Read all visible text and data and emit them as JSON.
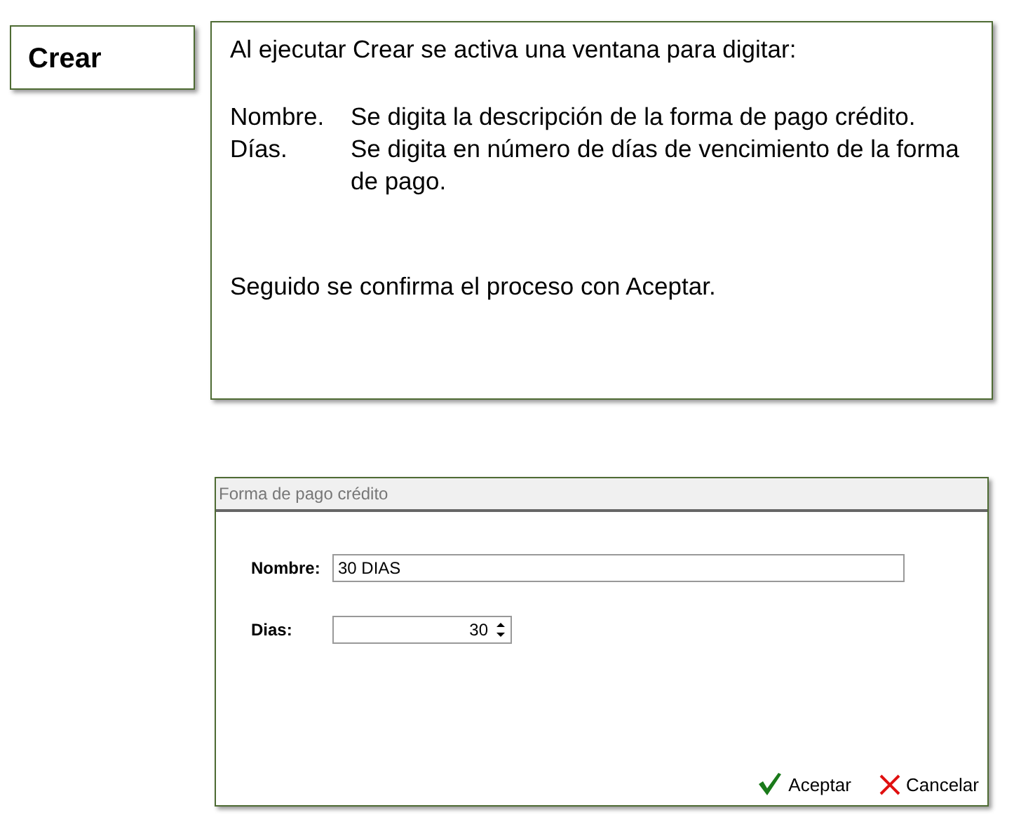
{
  "heading": "Crear",
  "note": {
    "intro": "Al ejecutar Crear se activa una ventana para digitar:",
    "definitions": [
      {
        "term": "Nombre.",
        "description": "Se digita la descripción de la forma de pago crédito."
      },
      {
        "term": "Días.",
        "description": "Se digita en número de días de vencimiento de la forma de pago."
      }
    ],
    "closing": "Seguido se confirma el proceso con Aceptar."
  },
  "dialog": {
    "title": "Forma de pago crédito",
    "fields": [
      {
        "kind": "text",
        "label": "Nombre:",
        "value": "30 DIAS"
      },
      {
        "kind": "spinner",
        "label": "Dias:",
        "value": "30"
      }
    ],
    "buttons": [
      {
        "kind": "accept",
        "label": "Aceptar"
      },
      {
        "kind": "cancel",
        "label": "Cancelar"
      }
    ]
  }
}
